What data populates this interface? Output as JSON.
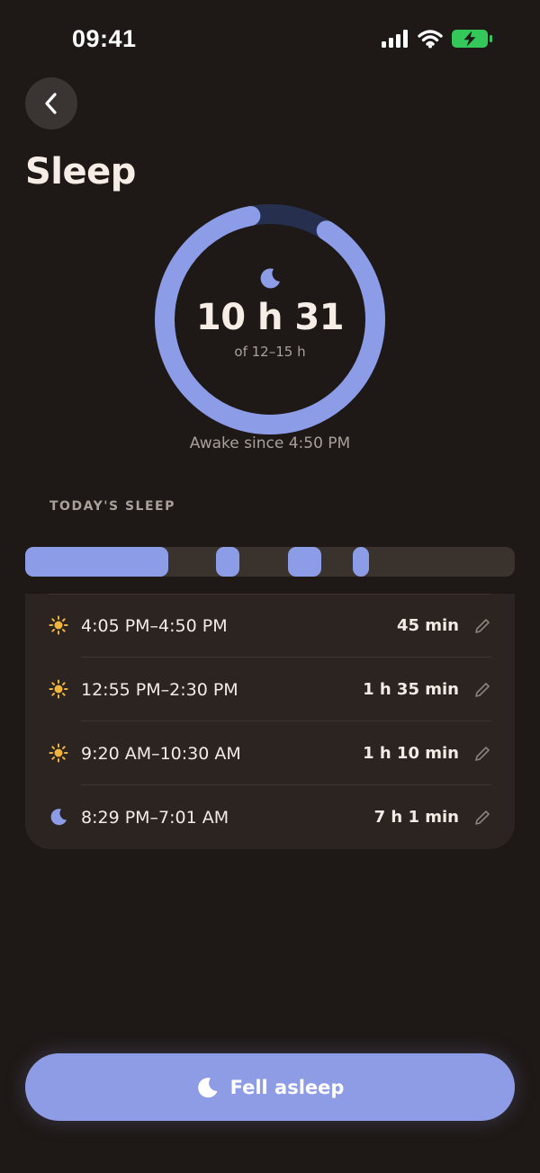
{
  "status_bar": {
    "time": "09:41"
  },
  "header": {
    "title": "Sleep"
  },
  "summary": {
    "total": "10 h 31",
    "goal": "of 12–15 h",
    "progress_fraction": 0.88,
    "awake_since": "Awake since 4:50 PM"
  },
  "section": {
    "label": "TODAY'S SLEEP"
  },
  "sessions": [
    {
      "icon": "sun-icon",
      "time": "4:05 PM–4:50 PM",
      "duration": "45 min"
    },
    {
      "icon": "sun-icon",
      "time": "12:55 PM–2:30 PM",
      "duration": "1 h 35 min"
    },
    {
      "icon": "sun-icon",
      "time": "9:20 AM–10:30 AM",
      "duration": "1 h 10 min"
    },
    {
      "icon": "moon-icon",
      "time": "8:29 PM–7:01 AM",
      "duration": "7 h 1 min"
    }
  ],
  "cta": {
    "label": "Fell asleep"
  },
  "colors": {
    "accent": "#8c9ce6",
    "background": "#1e1816",
    "card": "#2b2421",
    "sun": "#f0b43c"
  }
}
